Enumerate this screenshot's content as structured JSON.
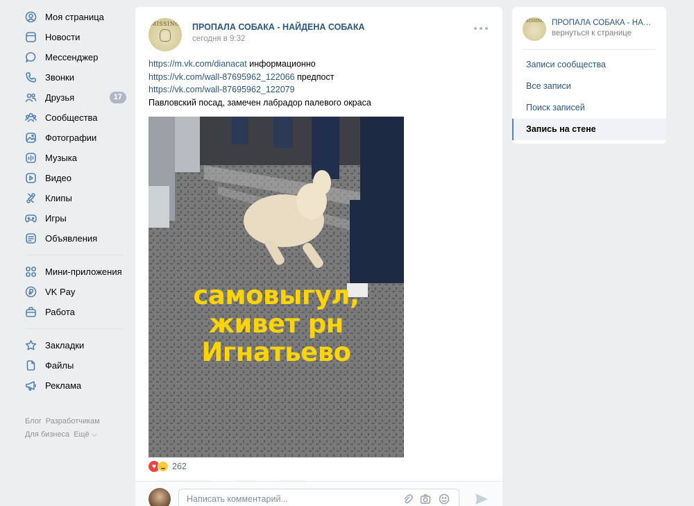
{
  "nav": {
    "items": [
      {
        "label": "Моя страница",
        "icon": "user-icon"
      },
      {
        "label": "Новости",
        "icon": "news-icon"
      },
      {
        "label": "Мессенджер",
        "icon": "message-icon"
      },
      {
        "label": "Звонки",
        "icon": "phone-icon"
      },
      {
        "label": "Друзья",
        "icon": "friends-icon",
        "badge": "17"
      },
      {
        "label": "Сообщества",
        "icon": "communities-icon"
      },
      {
        "label": "Фотографии",
        "icon": "photo-icon"
      },
      {
        "label": "Музыка",
        "icon": "music-icon"
      },
      {
        "label": "Видео",
        "icon": "video-icon"
      },
      {
        "label": "Клипы",
        "icon": "clips-icon"
      },
      {
        "label": "Игры",
        "icon": "gamepad-icon"
      },
      {
        "label": "Объявления",
        "icon": "ads-icon"
      }
    ],
    "items2": [
      {
        "label": "Мини-приложения",
        "icon": "apps-icon"
      },
      {
        "label": "VK Pay",
        "icon": "vkpay-icon"
      },
      {
        "label": "Работа",
        "icon": "briefcase-icon"
      }
    ],
    "items3": [
      {
        "label": "Закладки",
        "icon": "bookmark-icon"
      },
      {
        "label": "Файлы",
        "icon": "file-icon"
      },
      {
        "label": "Реклама",
        "icon": "megaphone-icon"
      }
    ],
    "footer": [
      "Блог",
      "Разработчикам",
      "Для бизнеса",
      "Ещё ⌵"
    ]
  },
  "post": {
    "group_name": "ПРОПАЛА СОБАКА - НАЙДЕНА СОБАКА",
    "time": "сегодня в 9:32",
    "avatar_text": "MISSING",
    "lines": [
      {
        "link": "https://m.vk.com/dianacat",
        "text": " информационно"
      },
      {
        "link": "https://vk.com/wall-87695962_122066",
        "text": " предпост"
      },
      {
        "link": "https://vk.com/wall-87695962_122079",
        "text": ""
      },
      {
        "link": "",
        "text": "Павловский посад, замечен лабрадор палевого окраса"
      }
    ],
    "photo_caption": [
      "самовыгул,",
      "живет рн",
      "Игнатьево"
    ],
    "reaction_count": "262",
    "comment_placeholder": "Написать комментарий..."
  },
  "right_panel": {
    "title": "ПРОПАЛА СОБАКА - НАЙДЕНА СОБАКА",
    "back": "вернуться к странице",
    "avatar_text": "MISSING",
    "menu": [
      {
        "label": "Записи сообщества",
        "active": false
      },
      {
        "label": "Все записи",
        "active": false
      },
      {
        "label": "Поиск записей",
        "active": false
      },
      {
        "label": "Запись на стене",
        "active": true
      }
    ]
  },
  "colors": {
    "link": "#2a5885",
    "accent": "#5181b8",
    "caption": "#ffd400",
    "background": "#edeef0"
  }
}
